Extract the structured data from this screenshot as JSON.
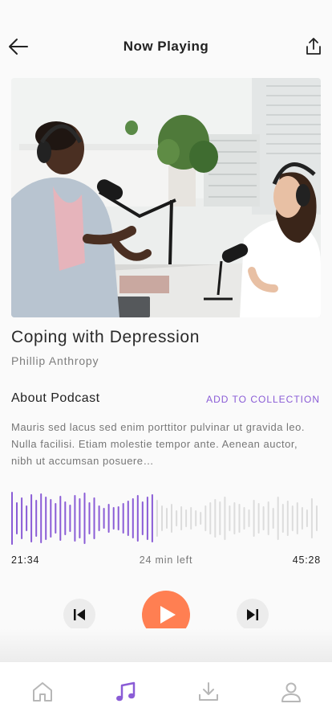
{
  "header": {
    "title": "Now Playing",
    "back_icon": "arrow-left-icon",
    "share_icon": "share-upload-icon"
  },
  "episode": {
    "title": "Coping with Depression",
    "author": "Phillip Anthropy"
  },
  "about": {
    "heading": "About Podcast",
    "add_label": "ADD TO COLLECTION",
    "description": "Mauris sed lacus sed enim porttitor pulvinar ut gravida leo. Nulla facilisi. Etiam molestie tempor ante. Aenean auctor, nibh ut accumsan posuere…"
  },
  "player": {
    "current_time": "21:34",
    "remaining": "24 min left",
    "total_time": "45:28",
    "progress": 0.47
  },
  "tabs": [
    {
      "name": "home",
      "icon": "home-icon",
      "active": false
    },
    {
      "name": "music",
      "icon": "music-note-icon",
      "active": true
    },
    {
      "name": "downloads",
      "icon": "download-icon",
      "active": false
    },
    {
      "name": "profile",
      "icon": "user-icon",
      "active": false
    }
  ],
  "colors": {
    "accent": "#8a5cd6",
    "play": "#ff7f52",
    "wave_played": "#8a5cd6",
    "wave_unplayed": "#dcdcdc"
  }
}
